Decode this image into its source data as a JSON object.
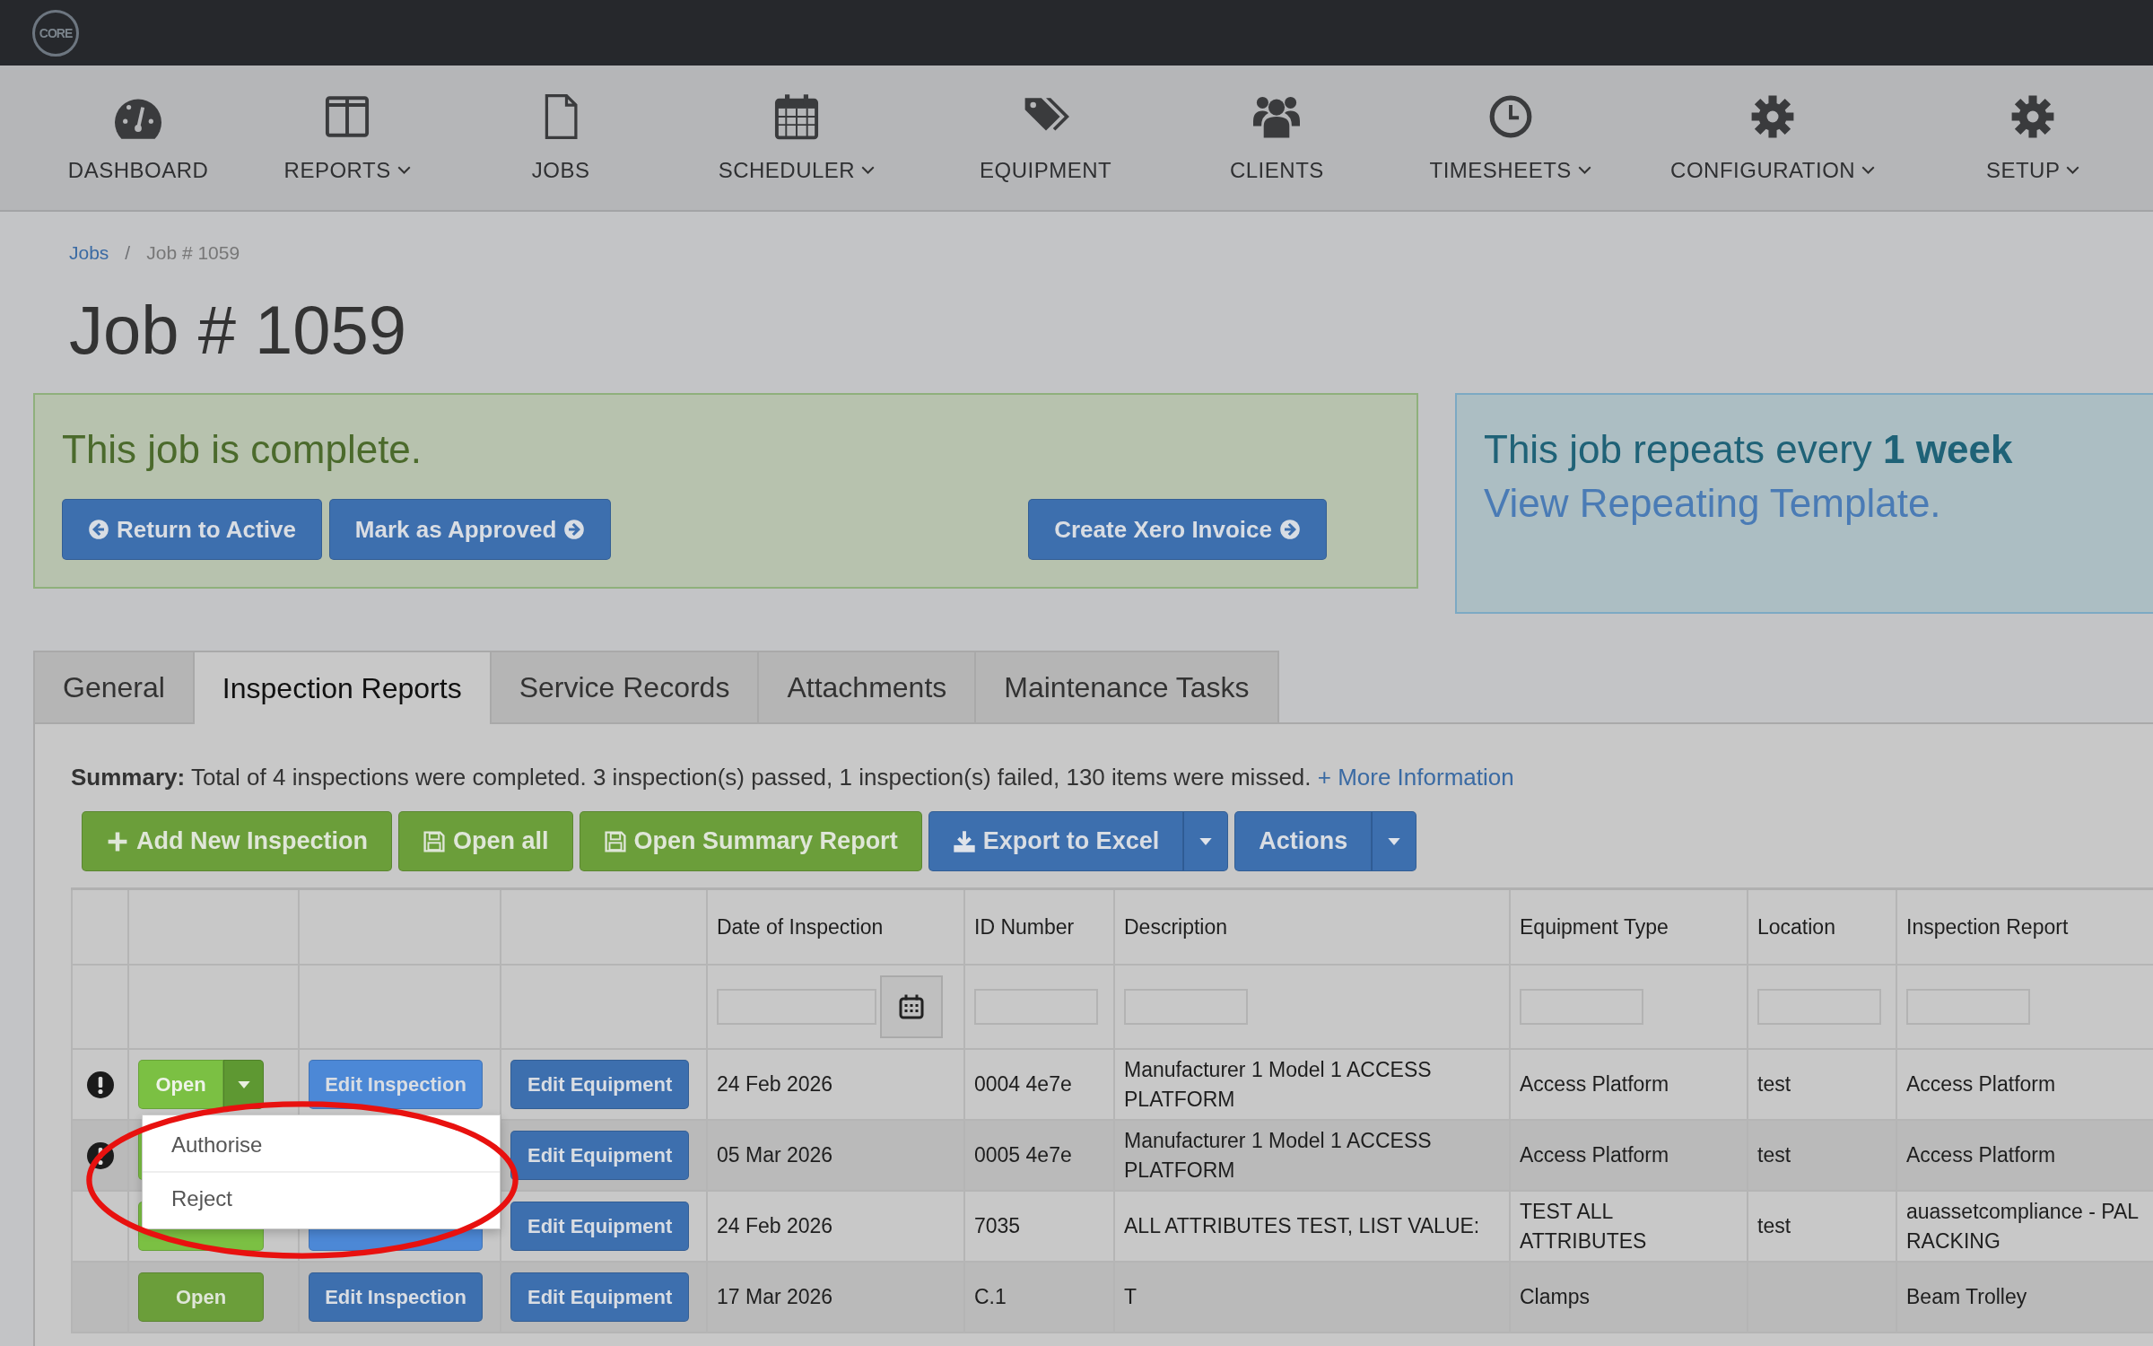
{
  "logo": "CORE",
  "nav": [
    {
      "label": "DASHBOARD",
      "dropdown": false
    },
    {
      "label": "REPORTS",
      "dropdown": true
    },
    {
      "label": "JOBS",
      "dropdown": false
    },
    {
      "label": "SCHEDULER",
      "dropdown": true
    },
    {
      "label": "EQUIPMENT",
      "dropdown": false
    },
    {
      "label": "CLIENTS",
      "dropdown": false
    },
    {
      "label": "TIMESHEETS",
      "dropdown": true
    },
    {
      "label": "CONFIGURATION",
      "dropdown": true
    },
    {
      "label": "SETUP",
      "dropdown": true
    }
  ],
  "breadcrumb": {
    "link": "Jobs",
    "separator": "/",
    "current": "Job # 1059"
  },
  "title": "Job # 1059",
  "complete_alert": {
    "message": "This job is complete.",
    "buttons": [
      {
        "label": "Return to Active",
        "kind": "back"
      },
      {
        "label": "Mark as Approved",
        "kind": "forward"
      },
      {
        "label": "Create Xero Invoice",
        "kind": "forward"
      }
    ]
  },
  "repeat_alert": {
    "message": "This job repeats every **1 week**",
    "link": "View Repeating Template."
  },
  "tabs": [
    {
      "label": "General",
      "selected": false
    },
    {
      "label": "Inspection Reports",
      "selected": true
    },
    {
      "label": "Service Records",
      "selected": false
    },
    {
      "label": "Attachments",
      "selected": false
    },
    {
      "label": "Maintenance Tasks",
      "selected": false
    }
  ],
  "summary": {
    "label": "Summary:",
    "text": "Total of 4 inspections were completed. 3 inspection(s) passed, 1 inspection(s) failed, 130 items were missed.",
    "link": "+ More Information"
  },
  "toolbar": [
    {
      "label": "Add New Inspection",
      "kind": "add",
      "caret": false
    },
    {
      "label": "Open all",
      "kind": "save",
      "caret": false
    },
    {
      "label": "Open Summary Report",
      "kind": "save",
      "caret": false
    },
    {
      "label": "Export to Excel",
      "kind": "export",
      "caret": true
    },
    {
      "label": "Actions",
      "kind": "plain",
      "caret": true
    }
  ],
  "table": {
    "columns": [
      "Date of Inspection",
      "ID Number",
      "Description",
      "Equipment Type",
      "Location",
      "Inspection Report"
    ],
    "rows": [
      {
        "flag": true,
        "open": "Open",
        "split": true,
        "edit_inspection": "Edit Inspection",
        "edit_equipment": "Edit Equipment",
        "cells": [
          "24 Feb 2026",
          "0004 4e7e",
          "Manufacturer 1 Model 1 ACCESS PLATFORM",
          "Access Platform",
          "test",
          "Access Platform"
        ]
      },
      {
        "flag": true,
        "split": false,
        "edit_equipment": "Edit Equipment",
        "cells": [
          "05 Mar 2026",
          "0005 4e7e",
          "Manufacturer 1 Model 1 ACCESS PLATFORM",
          "Access Platform",
          "test",
          "Access Platform"
        ]
      },
      {
        "flag": false,
        "split": false,
        "edit_equipment": "Edit Equipment",
        "cells": [
          "24 Feb 2026",
          "7035",
          "ALL ATTRIBUTES TEST, LIST VALUE:",
          "TEST ALL ATTRIBUTES",
          "test",
          "auassetcompliance - PAL\nRACKING"
        ]
      },
      {
        "flag": false,
        "open": "Open",
        "split": false,
        "edit_inspection": "Edit Inspection",
        "edit_equipment": "Edit Equipment",
        "cells": [
          "17 Mar 2026",
          "C.1",
          "T",
          "Clamps",
          "",
          "Beam Trolley"
        ]
      }
    ]
  },
  "dropdown_menu": [
    "Authorise",
    "Reject"
  ]
}
